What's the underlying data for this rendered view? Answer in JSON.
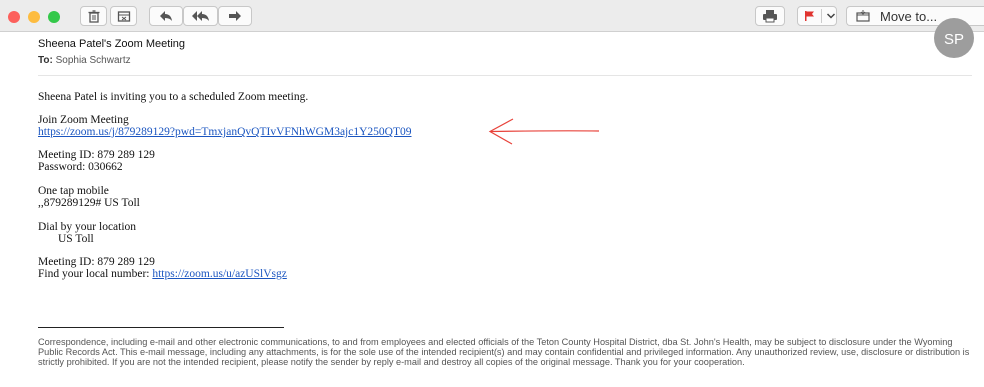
{
  "toolbar": {
    "traffic_lights": [
      "#fc605c",
      "#fdbc40",
      "#34c84a"
    ],
    "buttons": [
      "trash-icon",
      "junk-icon",
      "reply-icon",
      "reply-all-icon",
      "forward-icon",
      "print-icon",
      "flag-icon"
    ],
    "flag_color": "#e0332f",
    "move_label": "Move to..."
  },
  "header": {
    "subject": "Sheena Patel's Zoom Meeting",
    "to_label": "To:",
    "to_value": "Sophia Schwartz",
    "avatar_initials": "SP"
  },
  "body": {
    "intro": "Sheena Patel is inviting you to a scheduled Zoom meeting.",
    "join_label": "Join Zoom Meeting",
    "join_link": "https://zoom.us/j/879289129?pwd=TmxjanQvQTIvVFNhWGM3ajc1Y250QT09",
    "meeting_id_1": "Meeting ID: 879 289 129",
    "password": "Password: 030662",
    "one_tap_label": "One tap mobile",
    "one_tap_number": ",,879289129# US Toll",
    "dial_label": "Dial by your location",
    "dial_value": "US Toll",
    "meeting_id_2": "Meeting ID: 879 289 129",
    "find_label": "Find your local number: ",
    "find_link": "https://zoom.us/u/azUSlVsgz",
    "annotation_color": "#e8433b"
  },
  "footer": {
    "disclaimer": "Correspondence, including e-mail and other electronic communications, to and from employees and elected officials of the Teton County Hospital District, dba St. John's Health, may be subject to disclosure under the Wyoming Public Records Act. This e-mail message, including any attachments, is for the sole use of the intended recipient(s) and may contain confidential and privileged information. Any unauthorized review, use, disclosure or distribution is strictly prohibited. If you are not the intended recipient, please notify the sender by reply e-mail and destroy all copies of the original message. Thank you for your cooperation."
  }
}
